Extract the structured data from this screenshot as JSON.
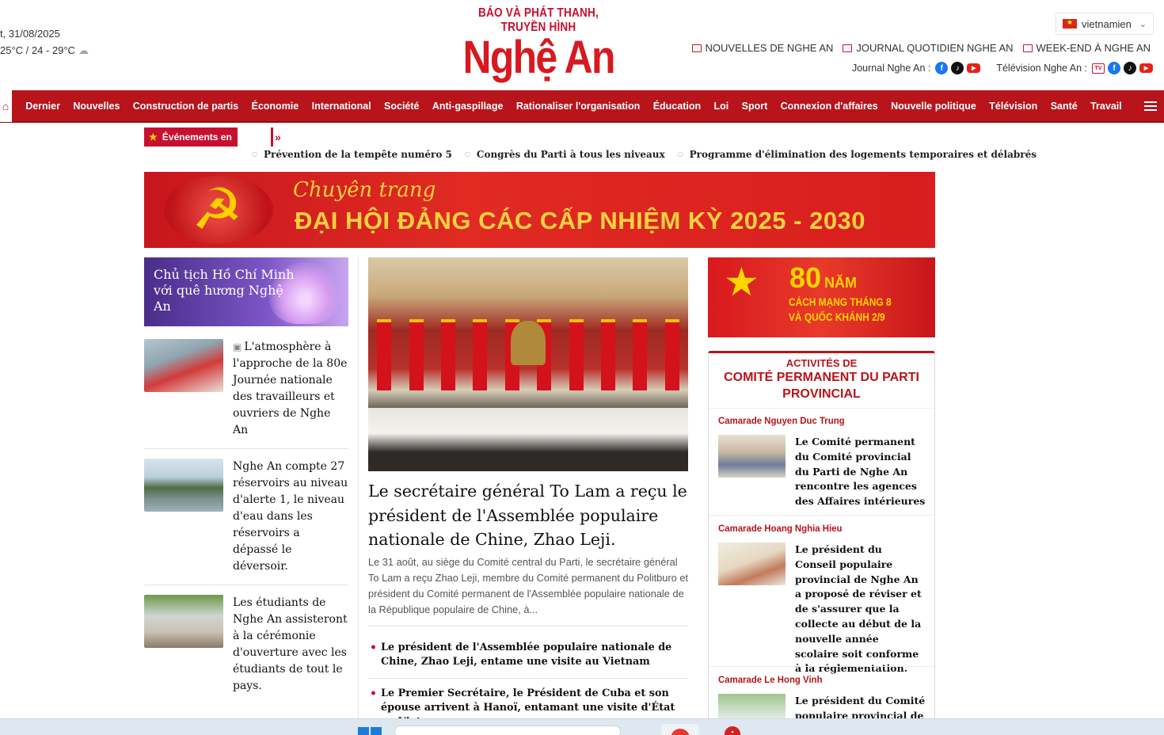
{
  "header": {
    "date": "t, 31/08/2025",
    "weather": "25°C / 24 - 29°C",
    "logo_sub": "BÁO VÀ PHÁT THANH, TRUYỀN HÌNH",
    "logo_main": "Nghệ An",
    "language": "vietnamien",
    "top_links": [
      "NOUVELLES DE NGHE AN",
      "JOURNAL QUOTIDIEN NGHE AN",
      "WEEK-END À NGHE AN"
    ],
    "journal_label": "Journal Nghe An :",
    "tv_label": "Télévision Nghe An :"
  },
  "nav": {
    "items": [
      "Dernier",
      "Nouvelles",
      "Construction de partis",
      "Économie",
      "International",
      "Société",
      "Anti-gaspillage",
      "Rationaliser l'organisation",
      "Éducation",
      "Loi",
      "Sport",
      "Connexion d'affaires",
      "Nouvelle politique",
      "Télévision",
      "Santé",
      "Travail"
    ]
  },
  "events": {
    "badge": "Événements en",
    "links": [
      "Prévention de la tempête numéro 5",
      "Congrès du Parti à tous les niveaux",
      "Programme d'élimination des logements temporaires et délabrés"
    ]
  },
  "banner": {
    "line1": "Chuyên trang",
    "line2": "ĐẠI HỘI ĐẢNG CÁC CẤP NHIỆM KỲ 2025 - 2030"
  },
  "left": {
    "promo": "Chủ tịch Hồ Chí Minh với quê hương Nghệ An",
    "news": [
      "L'atmosphère à l'approche de la 80e Journée nationale des travailleurs et ouvriers de Nghe An",
      "Nghe An compte 27 réservoirs au niveau d'alerte 1, le niveau d'eau dans les réservoirs a dépassé le déversoir.",
      "Les étudiants de Nghe An assisteront à la cérémonie d'ouverture avec les étudiants de tout le pays."
    ]
  },
  "center": {
    "title": "Le secrétaire général To Lam a reçu le président de l'Assemblée populaire nationale de Chine, Zhao Leji.",
    "desc": "Le 31 août, au siège du Comité central du Parti, le secrétaire général To Lam a reçu Zhao Leji, membre du Comité permanent du Politburo et président du Comité permanent de l'Assemblée populaire nationale de la République populaire de Chine, à...",
    "related": [
      "Le président de l'Assemblée populaire nationale de Chine, Zhao Leji, entame une visite au Vietnam",
      "Le Premier Secrétaire, le Président de Cuba et son épouse arrivent à Hanoï, entamant une visite d'État au Vietnam"
    ]
  },
  "right": {
    "promo_num": "80",
    "promo_nam": "NĂM",
    "promo_l1": "CÁCH MẠNG THÁNG 8",
    "promo_l2": "VÀ QUỐC KHÁNH 2/9",
    "box_h1": "ACTIVITÉS DE",
    "box_h2": "COMITÉ PERMANENT DU PARTI PROVINCIAL",
    "sections": [
      {
        "who": "Camarade Nguyen Duc Trung",
        "title": "Le Comité permanent du Comité provincial du Parti de Nghe An rencontre les agences des Affaires intérieures"
      },
      {
        "who": "Camarade Hoang Nghia Hieu",
        "title": "Le président du Conseil populaire provincial de Nghe An a proposé de réviser et de s'assurer que la collecte au début de la nouvelle année scolaire soit conforme à la réglementation."
      },
      {
        "who": "Camarade Le Hong Vinh",
        "title": "Le président du Comité populaire provincial de"
      }
    ]
  },
  "colors": {
    "brand": "#b8141b",
    "logo": "#d71920",
    "accent_gold": "#ffd23f"
  }
}
